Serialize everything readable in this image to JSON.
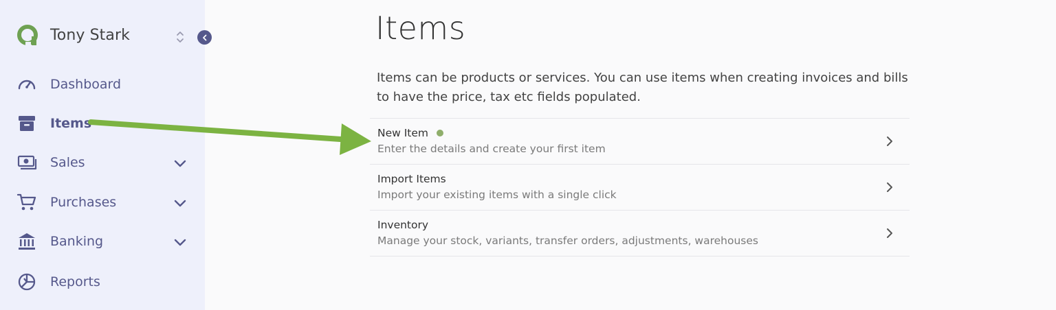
{
  "app": {
    "user_name": "Tony Stark"
  },
  "sidebar": {
    "items": [
      {
        "label": "Dashboard",
        "icon": "speedometer-icon"
      },
      {
        "label": "Items",
        "icon": "archive-box-icon",
        "active": true
      },
      {
        "label": "Sales",
        "icon": "cash-icon",
        "expandable": true
      },
      {
        "label": "Purchases",
        "icon": "shopping-cart-icon",
        "expandable": true
      },
      {
        "label": "Banking",
        "icon": "bank-icon",
        "expandable": true
      },
      {
        "label": "Reports",
        "icon": "pie-chart-icon"
      }
    ]
  },
  "main": {
    "title": "Items",
    "description": "Items can be products or services. You can use items when creating invoices and bills to have the price, tax etc fields populated.",
    "options": [
      {
        "title": "New Item",
        "description": "Enter the details and create your first item",
        "indicator": true
      },
      {
        "title": "Import Items",
        "description": "Import your existing items with a single click"
      },
      {
        "title": "Inventory",
        "description": "Manage your stock, variants, transfer orders, adjustments, warehouses"
      }
    ]
  },
  "colors": {
    "sidebar_bg": "#eef0fb",
    "nav_text": "#55588b",
    "brand_green": "#6ea152",
    "indicator_dot": "#8fae6b",
    "annotation_arrow": "#7cb342"
  }
}
